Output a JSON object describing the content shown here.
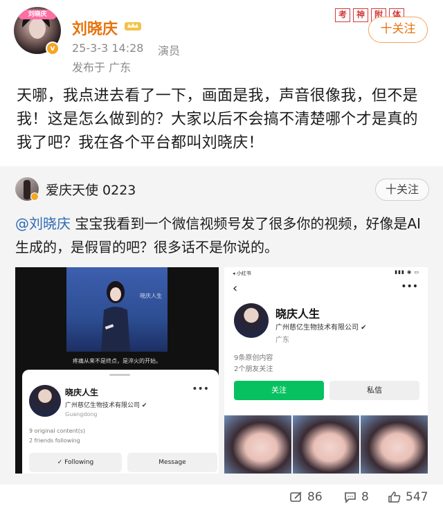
{
  "post": {
    "author": "刘晓庆",
    "avatar_sticker": "刘晓庆",
    "time": "25-3-3 14:28",
    "source": "演员",
    "location": "发布于 广东",
    "follow_label": "十关注",
    "stamps": [
      "考",
      "神",
      "附",
      "体"
    ],
    "text": "天哪，我点进去看了一下，画面是我，声音很像我，但不是我！这是怎么做到的？大家以后不会搞不清楚哪个才是真的我了吧？我在各个平台都叫刘晓庆！"
  },
  "repost": {
    "user": "爱庆天使 0223",
    "follow_label": "十关注",
    "mention": "@刘晓庆",
    "text": " 宝宝我看到一个微信视频号发了很多你的视频，好像是AI生成的，是假冒的吧？很多话不是你说的。",
    "left_screenshot": {
      "video_title": "晓庆人生",
      "subtitle": "疼痛从来不是终点，是淬火的开始。",
      "name": "晓庆人生",
      "more": "•••",
      "company": "广州慈亿生物技术有限公司 ✔",
      "region": "Guangdong",
      "content_count": "9 original content(s)",
      "friends": "2 friends following",
      "following_button": "✓ Following",
      "message_button": "Message"
    },
    "right_screenshot": {
      "app_label": "◂ 小红书",
      "status_icons": "▮▮▮ ◉ ▭",
      "back": "‹",
      "more": "•••",
      "name": "晓庆人生",
      "company": "广州慈亿生物技术有限公司 ✔",
      "region": "广东",
      "content_count": "9条原创内容",
      "friends": "2个朋友关注",
      "follow_button": "关注",
      "dm_button": "私信"
    }
  },
  "footer": {
    "reposts": "86",
    "comments": "8",
    "likes": "547"
  },
  "colors": {
    "author": "#e8730c",
    "mention": "#2d6ab4",
    "wechat_green": "#07c160",
    "verified": "#f5a623"
  }
}
